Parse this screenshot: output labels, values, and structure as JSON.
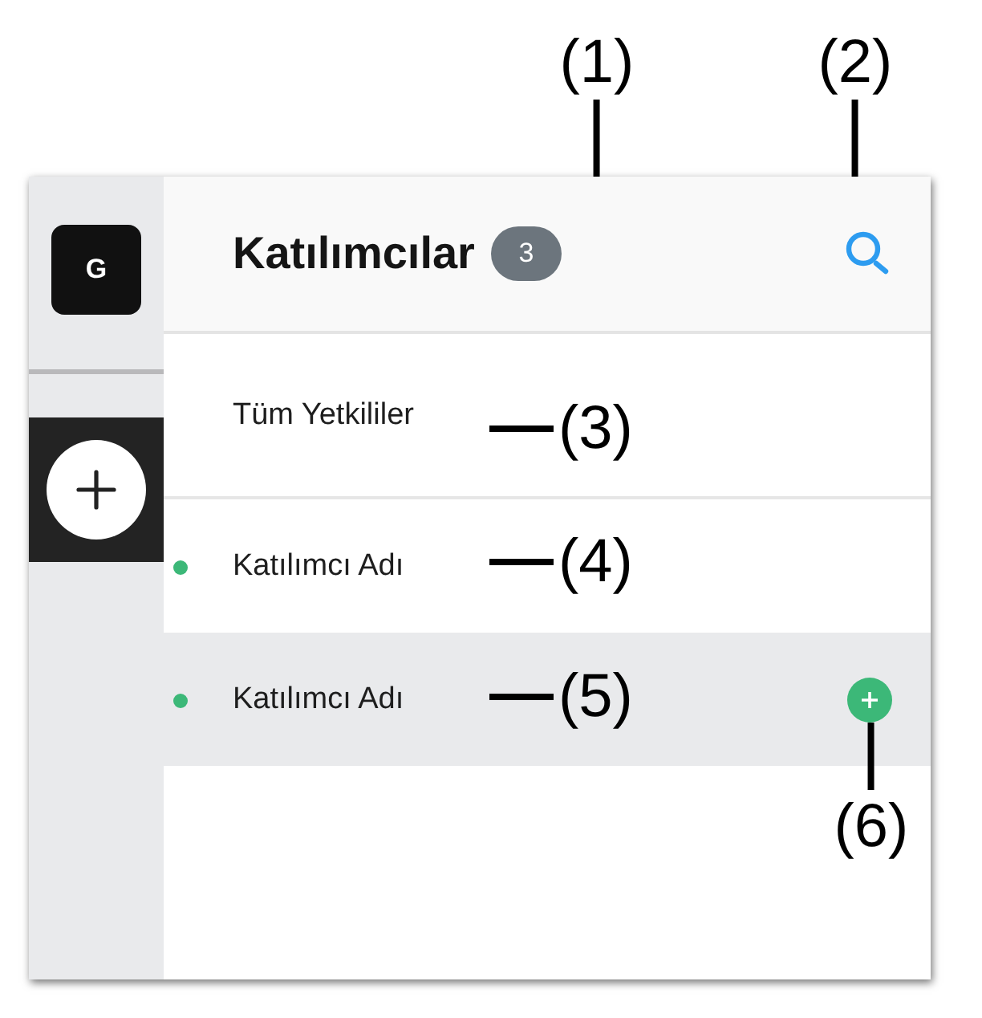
{
  "sidebar": {
    "avatar_letter": "G"
  },
  "header": {
    "title": "Katılımcılar",
    "count": "3"
  },
  "rows": [
    {
      "kind": "all",
      "label": "Tüm Yetkililer",
      "selected": false,
      "add_button": false
    },
    {
      "kind": "participant",
      "label": "Katılımcı Adı",
      "selected": false,
      "add_button": false,
      "color": "#3cb878"
    },
    {
      "kind": "participant",
      "label": "Katılımcı Adı",
      "selected": true,
      "add_button": true,
      "color": "#3cb878"
    }
  ],
  "callouts": [
    "(1)",
    "(2)",
    "(3)",
    "(4)",
    "(5)",
    "(6)"
  ]
}
